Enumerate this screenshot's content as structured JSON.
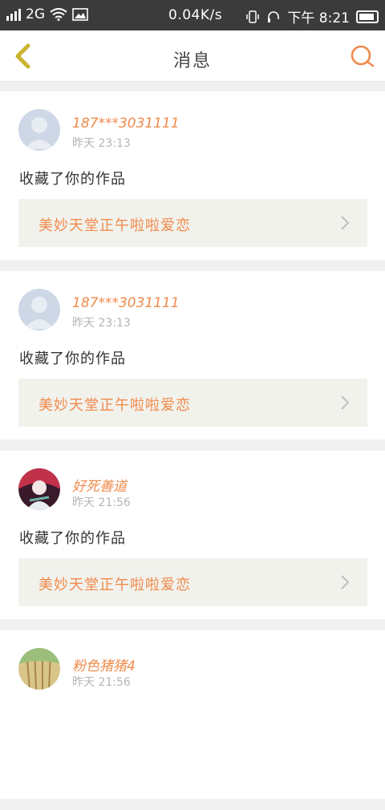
{
  "status_bar": {
    "network": "2G",
    "speed": "0.04K/s",
    "time": "下午 8:21"
  },
  "header": {
    "title": "消息",
    "back_icon": "chevron-left-icon",
    "search_icon": "search-icon"
  },
  "messages": [
    {
      "username": "187***3031111",
      "time": "昨天 23:13",
      "action": "收藏了你的作品",
      "work_title": "美妙天堂正午啦啦爱恋"
    },
    {
      "username": "187***3031111",
      "time": "昨天 23:13",
      "action": "收藏了你的作品",
      "work_title": "美妙天堂正午啦啦爱恋"
    },
    {
      "username": "好死善道",
      "time": "昨天 21:56",
      "action": "收藏了你的作品",
      "work_title": "美妙天堂正午啦啦爱恋"
    },
    {
      "username": "粉色猪猪4",
      "time": "昨天 21:56"
    }
  ],
  "colors": {
    "accent": "#f08a4b",
    "back_icon": "#c9b430",
    "status_bar": "#3b3b3b",
    "work_box": "#f2f2ed"
  }
}
